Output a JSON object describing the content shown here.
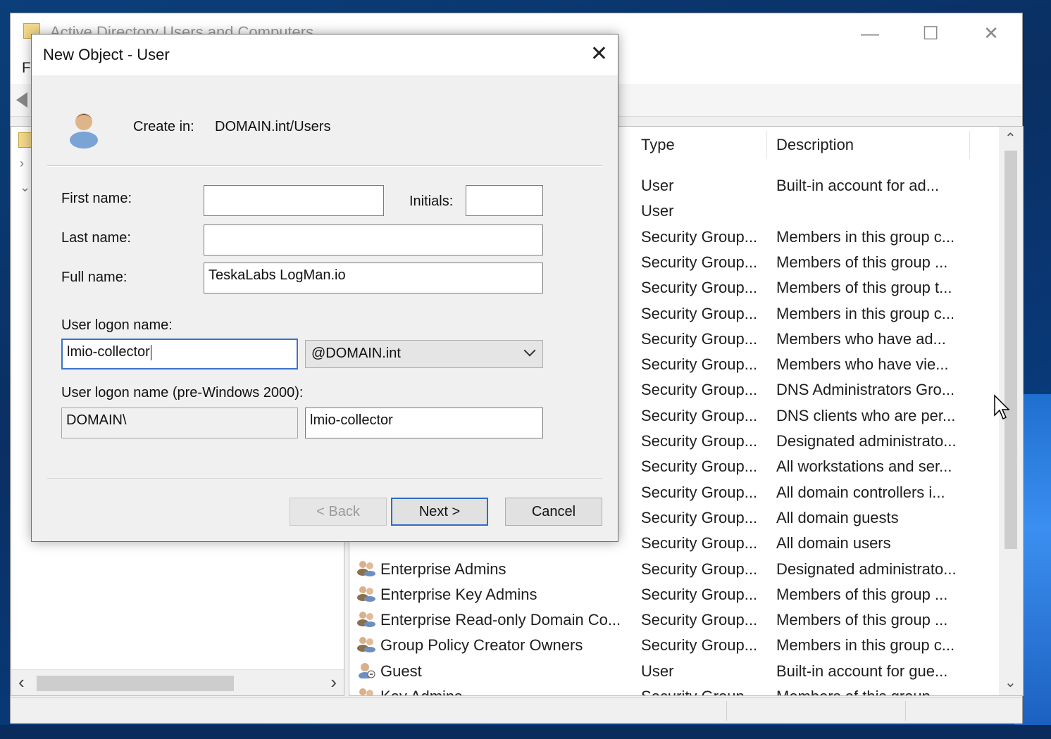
{
  "main_window": {
    "title": "Active Directory Users and Computers",
    "menu_first": "F"
  },
  "list": {
    "columns": [
      "Type",
      "Description"
    ],
    "rows": [
      {
        "name": "",
        "type": "User",
        "desc": "Built-in account for ad..."
      },
      {
        "name": "",
        "type": "User",
        "desc": ""
      },
      {
        "name": "",
        "type": "Security Group...",
        "desc": "Members in this group c..."
      },
      {
        "name": "",
        "type": "Security Group...",
        "desc": "Members of this group ..."
      },
      {
        "name": "",
        "type": "Security Group...",
        "desc": "Members of this group t..."
      },
      {
        "name": "",
        "type": "Security Group...",
        "desc": "Members in this group c..."
      },
      {
        "name": "",
        "type": "Security Group...",
        "desc": "Members who have ad..."
      },
      {
        "name": "",
        "type": "Security Group...",
        "desc": "Members who have vie..."
      },
      {
        "name": "",
        "type": "Security Group...",
        "desc": "DNS Administrators Gro..."
      },
      {
        "name": "",
        "type": "Security Group...",
        "desc": "DNS clients who are per..."
      },
      {
        "name": "",
        "type": "Security Group...",
        "desc": "Designated administrato..."
      },
      {
        "name": "",
        "type": "Security Group...",
        "desc": "All workstations and ser..."
      },
      {
        "name": "",
        "type": "Security Group...",
        "desc": "All domain controllers i..."
      },
      {
        "name": "",
        "type": "Security Group...",
        "desc": "All domain guests"
      },
      {
        "name": "",
        "type": "Security Group...",
        "desc": "All domain users"
      },
      {
        "name": "Enterprise Admins",
        "type": "Security Group...",
        "desc": "Designated administrato..."
      },
      {
        "name": "Enterprise Key Admins",
        "type": "Security Group...",
        "desc": "Members of this group ..."
      },
      {
        "name": "Enterprise Read-only Domain Co...",
        "type": "Security Group...",
        "desc": "Members of this group ..."
      },
      {
        "name": "Group Policy Creator Owners",
        "type": "Security Group...",
        "desc": "Members in this group c..."
      },
      {
        "name": "Guest",
        "type": "User",
        "desc": "Built-in account for gue..."
      },
      {
        "name": "Key Admins",
        "type": "Security Group...",
        "desc": "Members of this group ..."
      }
    ]
  },
  "dialog": {
    "title": "New Object - User",
    "create_in_label": "Create in:",
    "create_in_value": "DOMAIN.int/Users",
    "first_name_label": "First name:",
    "first_name_value": "",
    "initials_label": "Initials:",
    "initials_value": "",
    "last_name_label": "Last name:",
    "last_name_value": "",
    "full_name_label": "Full name:",
    "full_name_value": "TeskaLabs LogMan.io",
    "logon_label": "User logon name:",
    "logon_value": "lmio-collector",
    "domain_suffix": "@DOMAIN.int",
    "pre2000_label": "User logon name (pre-Windows 2000):",
    "pre2000_domain": "DOMAIN\\",
    "pre2000_value": "lmio-collector",
    "back_label": "< Back",
    "next_label": "Next >",
    "cancel_label": "Cancel"
  }
}
